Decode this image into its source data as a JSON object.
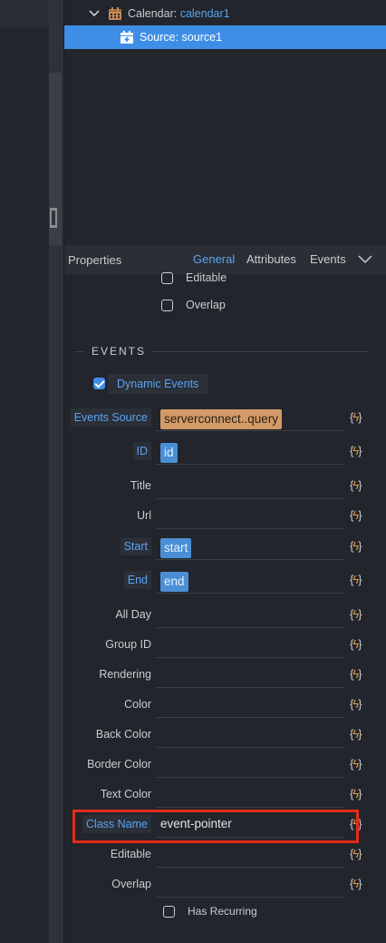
{
  "tree": {
    "calendar_label": "Calendar:",
    "calendar_name": "calendar1",
    "source_label": "Source: source1"
  },
  "properties": {
    "title": "Properties",
    "tabs": [
      "General",
      "Attributes",
      "Events"
    ],
    "active_tab": "General"
  },
  "top_checkboxes": [
    {
      "label": "Editable",
      "checked": false
    },
    {
      "label": "Overlap",
      "checked": false
    }
  ],
  "events_section": {
    "heading": "EVENTS",
    "dynamic_events": {
      "label": "Dynamic Events",
      "checked": true
    }
  },
  "fields": [
    {
      "label": "Events Source",
      "value": "serverconnect..query"
    },
    {
      "label": "ID",
      "value": "id"
    },
    {
      "label": "Title",
      "value": ""
    },
    {
      "label": "Url",
      "value": ""
    },
    {
      "label": "Start",
      "value": "start"
    },
    {
      "label": "End",
      "value": "end"
    },
    {
      "label": "All Day",
      "value": ""
    },
    {
      "label": "Group ID",
      "value": ""
    },
    {
      "label": "Rendering",
      "value": ""
    },
    {
      "label": "Color",
      "value": ""
    },
    {
      "label": "Back Color",
      "value": ""
    },
    {
      "label": "Border Color",
      "value": ""
    },
    {
      "label": "Text Color",
      "value": ""
    },
    {
      "label": "Class Name",
      "value": "event-pointer"
    },
    {
      "label": "Editable",
      "value": ""
    },
    {
      "label": "Overlap",
      "value": ""
    }
  ],
  "dynamic_button": {
    "left": "{",
    "right": "}"
  },
  "bottom_checkbox": {
    "label": "Has Recurring",
    "checked": false
  },
  "colors": {
    "accent": "#3e8ee8",
    "highlight_box": "#e52b1a",
    "tag_orange": "#d49a68",
    "tag_blue": "#4a8fd6"
  }
}
